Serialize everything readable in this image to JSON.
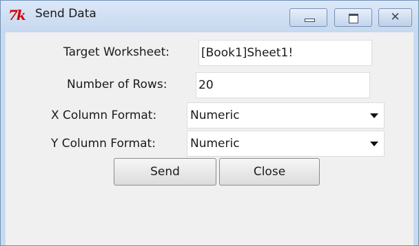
{
  "window": {
    "title": "Send Data",
    "logo_text": "7k",
    "controls": {
      "close_glyph": "✕"
    }
  },
  "form": {
    "target_worksheet": {
      "label": "Target Worksheet:",
      "value": "[Book1]Sheet1!"
    },
    "num_rows": {
      "label": "Number of Rows:",
      "value": "20"
    },
    "x_format": {
      "label": "X Column Format:",
      "value": "Numeric"
    },
    "y_format": {
      "label": "Y Column Format:",
      "value": "Numeric"
    }
  },
  "buttons": {
    "send": "Send",
    "close": "Close"
  }
}
